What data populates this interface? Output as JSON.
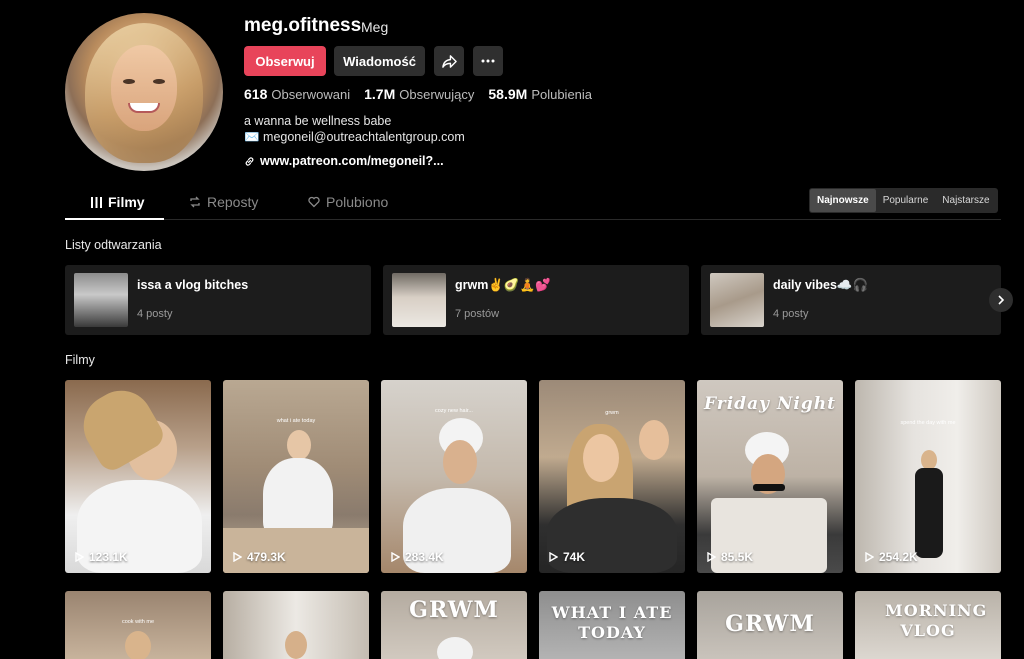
{
  "profile": {
    "username": "meg.ofitness",
    "nickname": "Meg",
    "follow_label": "Obserwuj",
    "message_label": "Wiadomość",
    "bio_line1": "a wanna be wellness babe",
    "bio_line2": "✉️ megoneil@outreachtalentgroup.com",
    "link": "www.patreon.com/megoneil?..."
  },
  "stats": [
    {
      "value": "618",
      "label": "Obserwowani"
    },
    {
      "value": "1.7M",
      "label": "Obserwujący"
    },
    {
      "value": "58.9M",
      "label": "Polubienia"
    }
  ],
  "tabs": [
    {
      "label": "Filmy",
      "icon": "grid-icon"
    },
    {
      "label": "Reposty",
      "icon": "repost-icon"
    },
    {
      "label": "Polubiono",
      "icon": "liked-icon"
    }
  ],
  "sort": [
    "Najnowsze",
    "Popularne",
    "Najstarsze"
  ],
  "sections": {
    "playlists": "Listy odtwarzania",
    "videos": "Filmy"
  },
  "playlists": [
    {
      "name": "issa a vlog bitches",
      "count": "4 posty"
    },
    {
      "name": "grwm✌️🥑🧘💕",
      "count": "7 postów"
    },
    {
      "name": "daily vibes☁️🎧",
      "count": "4 posty"
    }
  ],
  "videos": [
    {
      "views": "123.1K",
      "caption": ""
    },
    {
      "views": "479.3K",
      "caption": "what i ate today"
    },
    {
      "views": "283.4K",
      "caption": "cozy new hair..."
    },
    {
      "views": "74K",
      "caption": "grwm"
    },
    {
      "views": "85.5K",
      "caption": "Friday Night"
    },
    {
      "views": "254.2K",
      "caption": "spend the day with me"
    }
  ],
  "videos_row2": [
    {
      "caption": "cook with me"
    },
    {
      "caption": ""
    },
    {
      "caption": "GRWM"
    },
    {
      "caption": "WHAT I ATE TODAY"
    },
    {
      "caption": "GRWM"
    },
    {
      "caption": "MORNING VLOG"
    }
  ],
  "colors": {
    "accent": "#e8445a",
    "background": "#000000",
    "surface": "#1c1c1c"
  }
}
